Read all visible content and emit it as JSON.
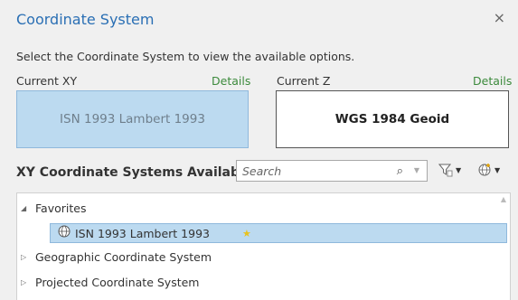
{
  "dialog": {
    "title": "Coordinate System",
    "close": "×"
  },
  "instruction": "Select the Coordinate System to view the available options.",
  "current_xy": {
    "label": "Current XY",
    "details": "Details",
    "value": "ISN 1993 Lambert 1993"
  },
  "current_z": {
    "label": "Current Z",
    "details": "Details",
    "value": "WGS 1984 Geoid"
  },
  "available": {
    "heading": "XY Coordinate Systems Available"
  },
  "search": {
    "placeholder": "Search",
    "value": ""
  },
  "icons": {
    "search": "⌕",
    "filter": "filter-icon",
    "globe_add": "globe-add-icon",
    "favorite": "★",
    "globe": "🌐"
  },
  "tree": {
    "favorites": {
      "label": "Favorites",
      "expanded": true,
      "items": [
        {
          "label": "ISN 1993 Lambert 1993",
          "favorite": true,
          "selected": true
        }
      ]
    },
    "geographic": {
      "label": "Geographic Coordinate System",
      "expanded": false
    },
    "projected": {
      "label": "Projected Coordinate System",
      "expanded": false
    }
  },
  "colors": {
    "title": "#2a6fb4",
    "details": "#3c8a3c",
    "selection": "#bcdaf0",
    "star": "#e8c21d"
  }
}
